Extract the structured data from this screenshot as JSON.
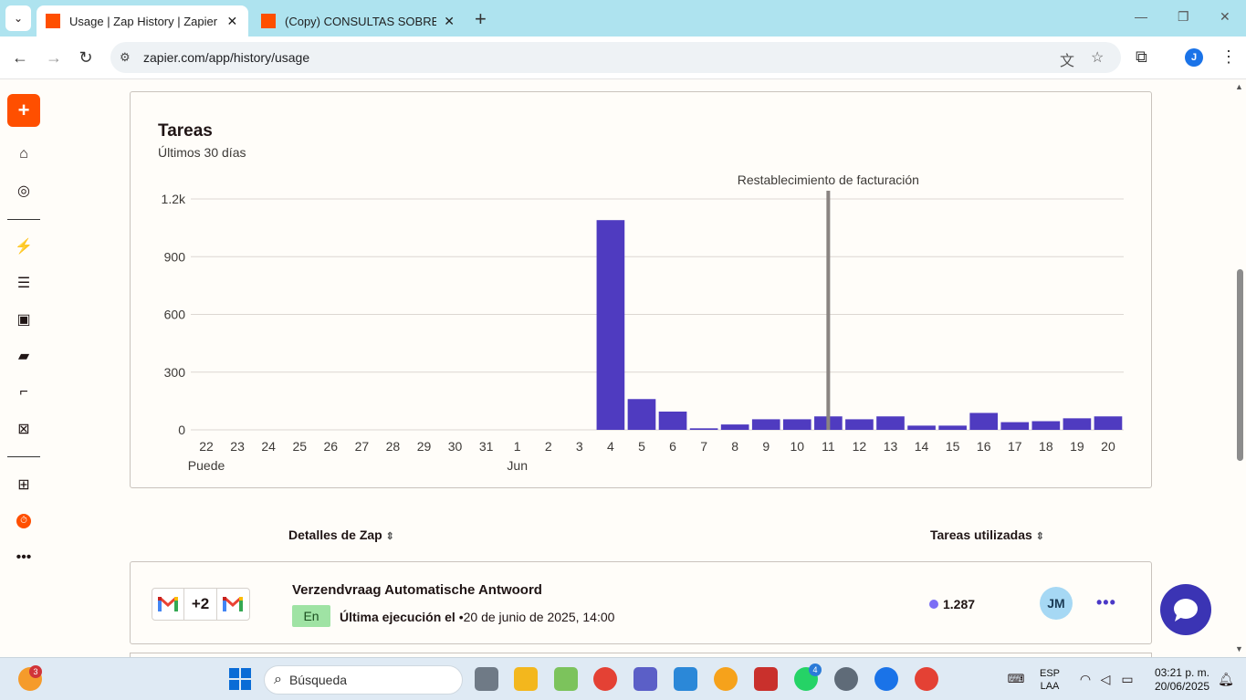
{
  "browser": {
    "tabs": [
      {
        "title": "Usage | Zap History | Zapier",
        "active": true
      },
      {
        "title": "(Copy) CONSULTAS SOBRE ACTIVOS",
        "active": false
      }
    ],
    "url": "zapier.com/app/history/usage",
    "profile_initial": "J"
  },
  "sidebar": {
    "create_label": "+",
    "items": [
      "home-icon",
      "globe-icon",
      "zap-icon",
      "tables-icon",
      "interfaces-icon",
      "chatbots-icon",
      "canvas-icon",
      "agents-icon",
      "apps-icon",
      "history-icon",
      "more-icon"
    ]
  },
  "chart_card": {
    "title": "Tareas",
    "subtitle": "Últimos 30 días"
  },
  "chart_data": {
    "type": "bar",
    "categories": [
      "22",
      "23",
      "24",
      "25",
      "26",
      "27",
      "28",
      "29",
      "30",
      "31",
      "1",
      "2",
      "3",
      "4",
      "5",
      "6",
      "7",
      "8",
      "9",
      "10",
      "11",
      "12",
      "13",
      "14",
      "15",
      "16",
      "17",
      "18",
      "19",
      "20"
    ],
    "month_labels": [
      {
        "at": "22",
        "label": "Puede"
      },
      {
        "at": "1",
        "label": "Jun"
      }
    ],
    "values": [
      0,
      0,
      0,
      0,
      0,
      0,
      0,
      0,
      0,
      0,
      0,
      0,
      0,
      1090,
      160,
      95,
      8,
      28,
      55,
      55,
      70,
      55,
      70,
      22,
      22,
      88,
      40,
      45,
      60,
      70
    ],
    "yticks": [
      0,
      300,
      600,
      900,
      1200
    ],
    "ytick_labels": [
      "0",
      "300",
      "600",
      "900",
      "1.2k"
    ],
    "ylim": [
      0,
      1200
    ],
    "annotation": {
      "at": "11",
      "label": "Restablecimiento de facturación"
    },
    "bar_color": "#4f3bc0",
    "grid": true
  },
  "table": {
    "col_details": "Detalles de Zap",
    "col_tasks": "Tareas utilizadas",
    "sort_icon": "⌃⌄"
  },
  "zap": {
    "extra_apps": "+2",
    "title": "Verzendvraag Automatische Antwoord",
    "status": "En",
    "last_run_label": "Última ejecución el",
    "last_run_value": " •20 de junio de 2025, 14:00",
    "tasks": "1.287",
    "owner_initials": "JM",
    "menu": "•••"
  },
  "taskbar": {
    "search_placeholder": "Búsqueda",
    "lang_line1": "ESP",
    "lang_line2": "LAA",
    "time": "03:21 p. m.",
    "date": "20/06/2025",
    "weather_badge": "3",
    "whatsapp_badge": "4"
  }
}
